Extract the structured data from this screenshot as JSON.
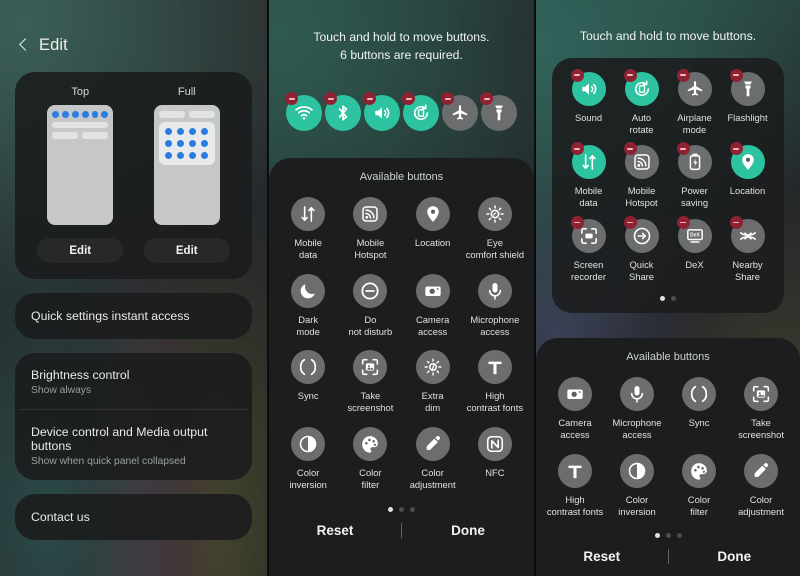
{
  "theme": {
    "accent_teal": "#2dc3a0",
    "badge_red": "#8e2232",
    "tile_gray": "#6b6d6e",
    "blue_dot": "#2a7de1"
  },
  "panel1": {
    "back_label": "Edit",
    "layout_card": {
      "options": [
        {
          "label": "Top",
          "edit_label": "Edit"
        },
        {
          "label": "Full",
          "edit_label": "Edit"
        }
      ]
    },
    "rows": [
      {
        "title": "Quick settings instant access",
        "sub": ""
      },
      {
        "title": "Brightness control",
        "sub": "Show always"
      },
      {
        "title": "Device control and Media output buttons",
        "sub": "Show when quick panel collapsed"
      },
      {
        "title": "Contact us",
        "sub": ""
      }
    ]
  },
  "panel2": {
    "hint_line1": "Touch and hold to move buttons.",
    "hint_line2": "6 buttons are required.",
    "active_buttons": [
      {
        "label": "Wi-Fi",
        "icon": "wifi-icon",
        "on": true
      },
      {
        "label": "Bluetooth",
        "icon": "bluetooth-icon",
        "on": true
      },
      {
        "label": "Sound",
        "icon": "sound-icon",
        "on": true
      },
      {
        "label": "Auto rotate",
        "icon": "auto-rotate-icon",
        "on": true
      },
      {
        "label": "Airplane mode",
        "icon": "airplane-icon",
        "on": false
      },
      {
        "label": "Flashlight",
        "icon": "flashlight-icon",
        "on": false
      }
    ],
    "available_title": "Available buttons",
    "available_buttons": [
      {
        "label": "Mobile data",
        "icon": "mobile-data-icon"
      },
      {
        "label": "Mobile Hotspot",
        "icon": "hotspot-icon"
      },
      {
        "label": "Location",
        "icon": "location-icon"
      },
      {
        "label": "Eye comfort shield",
        "icon": "eye-comfort-icon"
      },
      {
        "label": "Dark mode",
        "icon": "dark-mode-icon"
      },
      {
        "label": "Do not disturb",
        "icon": "do-not-disturb-icon"
      },
      {
        "label": "Camera access",
        "icon": "camera-icon"
      },
      {
        "label": "Microphone access",
        "icon": "microphone-icon"
      },
      {
        "label": "Sync",
        "icon": "sync-icon"
      },
      {
        "label": "Take screenshot",
        "icon": "screenshot-icon"
      },
      {
        "label": "Extra dim",
        "icon": "extra-dim-icon"
      },
      {
        "label": "High contrast fonts",
        "icon": "high-contrast-fonts-icon"
      },
      {
        "label": "Color inversion",
        "icon": "color-inversion-icon"
      },
      {
        "label": "Color filter",
        "icon": "color-filter-icon"
      },
      {
        "label": "Color adjustment",
        "icon": "color-adjustment-icon"
      },
      {
        "label": "NFC",
        "icon": "nfc-icon"
      }
    ],
    "pager": {
      "count": 3,
      "active": 0
    },
    "reset_label": "Reset",
    "done_label": "Done"
  },
  "panel3": {
    "hint_line1": "Touch and hold to move buttons.",
    "active_buttons": [
      {
        "label": "Sound",
        "icon": "sound-icon",
        "on": true
      },
      {
        "label": "Auto rotate",
        "icon": "auto-rotate-icon",
        "on": true
      },
      {
        "label": "Airplane mode",
        "icon": "airplane-icon",
        "on": false
      },
      {
        "label": "Flashlight",
        "icon": "flashlight-icon",
        "on": false
      },
      {
        "label": "Mobile data",
        "icon": "mobile-data-icon",
        "on": true
      },
      {
        "label": "Mobile Hotspot",
        "icon": "hotspot-icon",
        "on": false
      },
      {
        "label": "Power saving",
        "icon": "power-saving-icon",
        "on": false
      },
      {
        "label": "Location",
        "icon": "location-icon",
        "on": true
      },
      {
        "label": "Screen recorder",
        "icon": "screen-recorder-icon",
        "on": false
      },
      {
        "label": "Quick Share",
        "icon": "quick-share-icon",
        "on": false
      },
      {
        "label": "DeX",
        "icon": "dex-icon",
        "on": false
      },
      {
        "label": "Nearby Share",
        "icon": "nearby-share-icon",
        "on": false
      }
    ],
    "top_pager": {
      "count": 2,
      "active": 0
    },
    "available_title": "Available buttons",
    "available_buttons": [
      {
        "label": "Camera access",
        "icon": "camera-icon"
      },
      {
        "label": "Microphone access",
        "icon": "microphone-icon"
      },
      {
        "label": "Sync",
        "icon": "sync-icon"
      },
      {
        "label": "Take screenshot",
        "icon": "screenshot-icon"
      },
      {
        "label": "High contrast fonts",
        "icon": "high-contrast-fonts-icon"
      },
      {
        "label": "Color inversion",
        "icon": "color-inversion-icon"
      },
      {
        "label": "Color filter",
        "icon": "color-filter-icon"
      },
      {
        "label": "Color adjustment",
        "icon": "color-adjustment-icon"
      }
    ],
    "pager": {
      "count": 3,
      "active": 0
    },
    "reset_label": "Reset",
    "done_label": "Done"
  }
}
